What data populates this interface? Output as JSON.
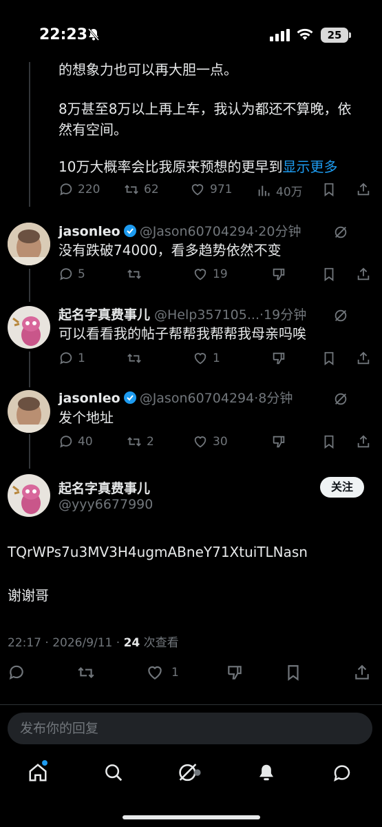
{
  "status_bar": {
    "time": "22:23",
    "battery": "25"
  },
  "top_post": {
    "line1": "的想象力也可以再大胆一点。",
    "line2a": "8万甚至8万以上再上车，我认为都还不算晚，依",
    "line2b": "然有空间。",
    "line3": "10万大概率会比我原来预想的更早到",
    "show_more": "显示更多",
    "replies": "220",
    "reposts": "62",
    "likes": "971",
    "views": "40万"
  },
  "replies": [
    {
      "name": "jasonleo",
      "handle": "@Jason60704294",
      "time": "20分钟",
      "text": "没有跌破74000，看多趋势依然不变",
      "replies": "5",
      "reposts": "",
      "likes": "19"
    },
    {
      "name": "起名字真费事儿",
      "handle": "@Help357105...",
      "time": "19分钟",
      "text": "可以看看我的帖子帮帮我帮帮我母亲吗唉",
      "replies": "1",
      "reposts": "",
      "likes": "1"
    },
    {
      "name": "jasonleo",
      "handle": "@Jason60704294",
      "time": "8分钟",
      "text": "发个地址",
      "replies": "40",
      "reposts": "2",
      "likes": "30"
    }
  ],
  "main_post": {
    "name": "起名字真费事儿",
    "handle": "@yyy6677990",
    "follow_label": "关注",
    "body1": "TQrWPs7u3MV3H4ugmABneY71XtuiTLNasn",
    "body2": "谢谢哥",
    "meta_time": "22:17 · 2026/9/11 · ",
    "meta_views_count": "24",
    "meta_views_label": " 次查看",
    "likes": "1"
  },
  "reply_box": {
    "placeholder": "发布你的回复"
  },
  "colors": {
    "accent": "#1d9bf0",
    "muted": "#71767b",
    "text": "#e7e9ea",
    "background": "#000000"
  }
}
